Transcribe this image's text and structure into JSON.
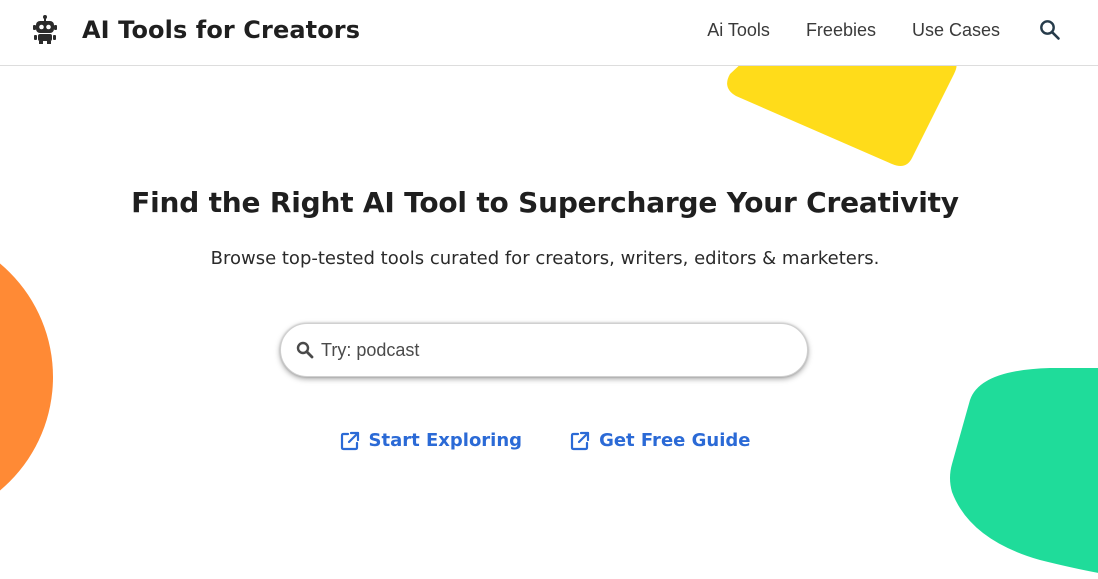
{
  "header": {
    "brand_title": "AI Tools for Creators",
    "logo_icon": "robot-icon",
    "nav": [
      {
        "label": "Ai Tools"
      },
      {
        "label": "Freebies"
      },
      {
        "label": "Use Cases"
      }
    ],
    "search_icon": "search-icon"
  },
  "hero": {
    "title": "Find the Right AI Tool to Supercharge Your Creativity",
    "subtitle": "Browse top-tested tools curated for creators, writers, editors & marketers.",
    "search": {
      "placeholder": "Try: podcast",
      "value": ""
    },
    "ctas": [
      {
        "label": "Start Exploring",
        "icon": "external-link-icon"
      },
      {
        "label": "Get Free Guide",
        "icon": "external-link-icon"
      }
    ]
  },
  "colors": {
    "accent_blue": "#2b6ad6",
    "yellow_shape": "#ffdc1a",
    "orange_shape": "#ff8a35",
    "green_shape": "#1fdc9a",
    "text_dark": "#1f1f1f"
  }
}
